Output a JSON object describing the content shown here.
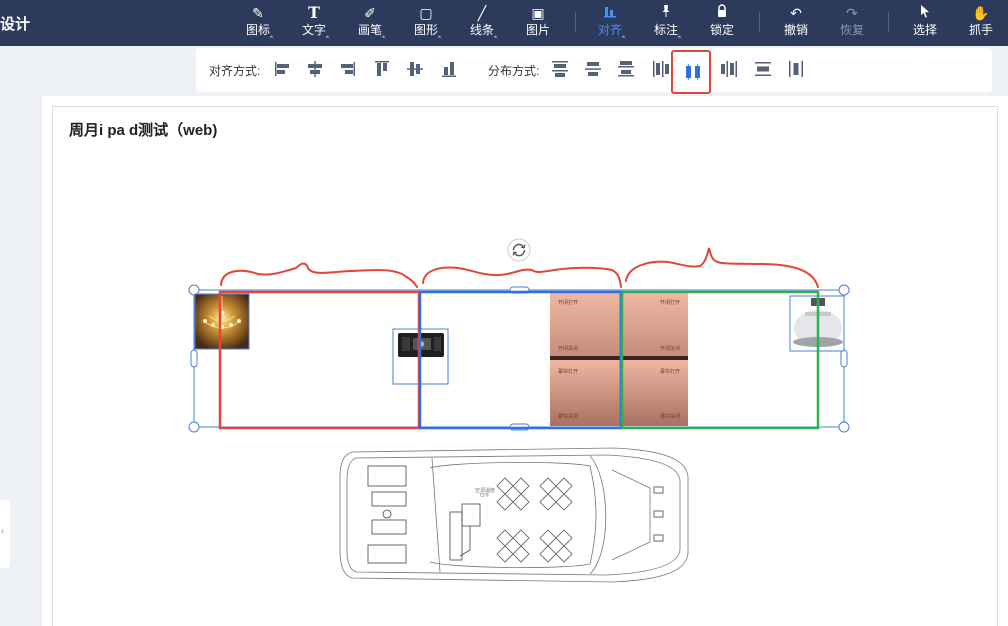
{
  "app": {
    "title": "设计"
  },
  "toolbar": {
    "items": [
      {
        "label": "图标",
        "icon": "icon-library-icon",
        "glyph": "✎"
      },
      {
        "label": "文字",
        "icon": "text-icon",
        "glyph": "T"
      },
      {
        "label": "画笔",
        "icon": "brush-icon",
        "glyph": "✐"
      },
      {
        "label": "图形",
        "icon": "shape-icon",
        "glyph": "▢"
      },
      {
        "label": "线条",
        "icon": "line-icon",
        "glyph": "╱"
      },
      {
        "label": "图片",
        "icon": "image-icon",
        "glyph": "▣"
      },
      {
        "label": "对齐",
        "icon": "align-icon",
        "glyph": "▮▮"
      },
      {
        "label": "标注",
        "icon": "pin-icon",
        "glyph": "⚲"
      },
      {
        "label": "锁定",
        "icon": "lock-icon",
        "glyph": "🔒"
      },
      {
        "label": "撤销",
        "icon": "undo-icon",
        "glyph": "↶"
      },
      {
        "label": "恢复",
        "icon": "redo-icon",
        "glyph": "↷"
      },
      {
        "label": "选择",
        "icon": "cursor-icon",
        "glyph": "➤"
      },
      {
        "label": "抓手",
        "icon": "hand-icon",
        "glyph": "✋"
      }
    ],
    "active": "对齐",
    "disabled": "恢复"
  },
  "alignbar": {
    "align_label": "对齐方式:",
    "distribute_label": "分布方式:",
    "align_buttons": [
      "align-left-icon",
      "align-center-h-icon",
      "align-right-icon",
      "align-top-icon",
      "align-middle-v-icon",
      "align-bottom-icon"
    ],
    "distribute_buttons": [
      "distribute-top-icon",
      "distribute-middle-icon",
      "distribute-bottom-icon",
      "distribute-left-icon",
      "distribute-center-h-icon",
      "distribute-right-icon",
      "distribute-spacing-v-icon",
      "distribute-spacing-h-icon"
    ],
    "selected_button": "distribute-center-h-icon"
  },
  "canvas": {
    "page_title": "周月i pa d测试（web)",
    "panel_labels": [
      "开闭打开",
      "开闭关闭",
      "开闭打开",
      "开闭关闭",
      "幕帘打开",
      "幕帘关闭",
      "幕帘打开",
      "幕帘关闭"
    ],
    "vehicle_label_line1": "空调温度",
    "vehicle_label_line2": "73℉",
    "annotation_colors": {
      "red": "#e0463a",
      "blue": "#2f6fe0",
      "green": "#2fb14a"
    }
  },
  "colors": {
    "topbar": "#2c3a5c",
    "accent": "#4c8df6",
    "selection": "#4a7fd4"
  }
}
